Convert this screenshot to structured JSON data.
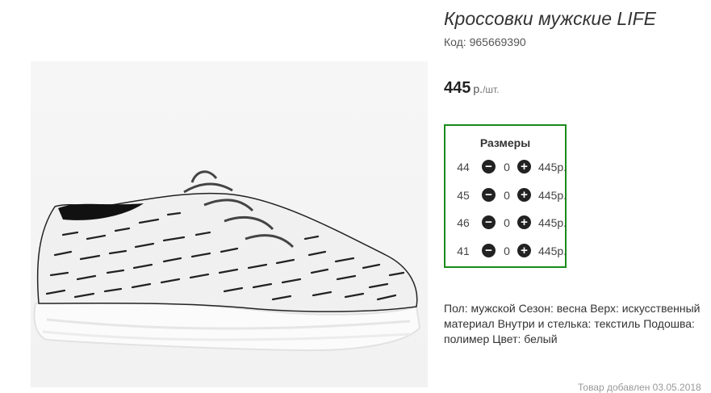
{
  "product": {
    "title": "Кроссовки мужские LIFE",
    "code": "Код: 965669390",
    "price": "445",
    "currency": "р.",
    "unit": "/шт.",
    "image_alt": "Белые кроссовки с чёрным принтом"
  },
  "sizes": {
    "title": "Размеры",
    "border_color": "#1a8a1a",
    "rows": [
      {
        "size": "44",
        "qty": "0",
        "price": "445р."
      },
      {
        "size": "45",
        "qty": "0",
        "price": "445р."
      },
      {
        "size": "46",
        "qty": "0",
        "price": "445р."
      },
      {
        "size": "41",
        "qty": "0",
        "price": "445р."
      }
    ],
    "minus_icon": "minus-circle-icon",
    "plus_icon": "plus-circle-icon"
  },
  "description": "Пол: мужской Сезон: весна Верх: искусственный материал Внутри и стелька: текстиль Подошва: полимер Цвет: белый",
  "added": "Товар добавлен 03.05.2018"
}
